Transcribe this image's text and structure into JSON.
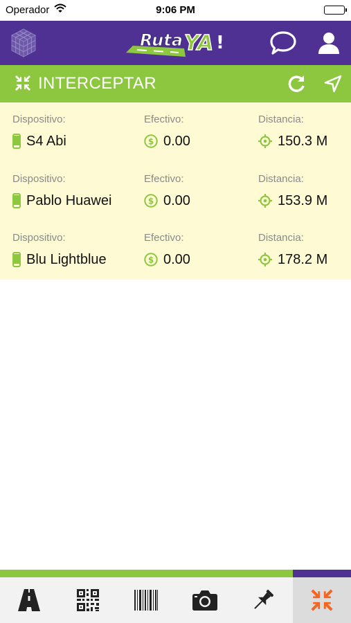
{
  "status_bar": {
    "carrier": "Operador",
    "time": "9:06 PM"
  },
  "header": {
    "logo": "RutaYA!",
    "icons": [
      "cube-icon",
      "chat-bubble-icon",
      "user-icon"
    ],
    "color": "#4f3193"
  },
  "section": {
    "title": "INTERCEPTAR",
    "icons": [
      "collapse-arrows-icon",
      "refresh-icon",
      "navigation-arrow-icon"
    ],
    "color": "#8dc63f"
  },
  "columns": {
    "device_label": "Dispositivo:",
    "cash_label": "Efectivo:",
    "distance_label": "Distancia:"
  },
  "devices": [
    {
      "name": "S4 Abi",
      "cash": "0.00",
      "distance": "150.3 M"
    },
    {
      "name": "Pablo Huawei",
      "cash": "0.00",
      "distance": "153.9 M"
    },
    {
      "name": "Blu Lightblue",
      "cash": "0.00",
      "distance": "178.2 M"
    }
  ],
  "tab_bar": {
    "tabs": [
      "road-icon",
      "qr-code-icon",
      "barcode-icon",
      "camera-icon",
      "pin-icon",
      "intercept-icon"
    ],
    "active": "intercept-icon",
    "active_color": "#f26522"
  }
}
